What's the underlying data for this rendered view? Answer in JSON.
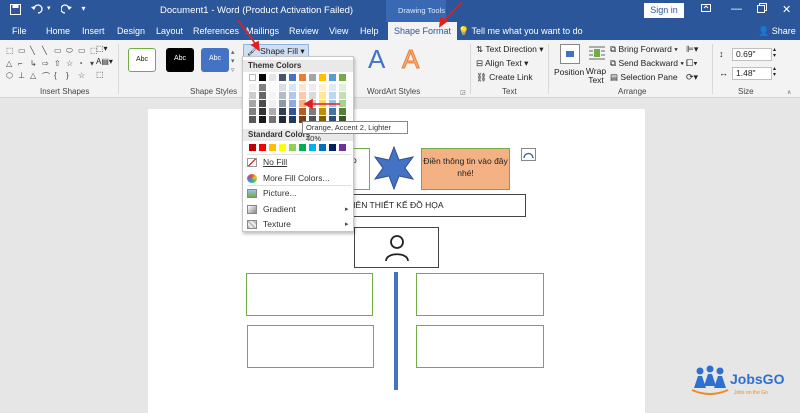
{
  "titlebar": {
    "save_icon": "save-icon",
    "undo_icon": "undo-icon",
    "redo_icon": "redo-icon",
    "customize_icon": "customize-icon",
    "title": "Document1 - Word (Product Activation Failed)",
    "context_label": "Drawing Tools",
    "signin": "Sign in"
  },
  "tabs": [
    {
      "label": "File"
    },
    {
      "label": "Home"
    },
    {
      "label": "Insert"
    },
    {
      "label": "Design"
    },
    {
      "label": "Layout"
    },
    {
      "label": "References"
    },
    {
      "label": "Mailings"
    },
    {
      "label": "Review"
    },
    {
      "label": "View"
    },
    {
      "label": "Help"
    },
    {
      "label": "Shape Format"
    }
  ],
  "tell_me": "Tell me what you want to do",
  "share": "Share",
  "ribbon": {
    "insert_shapes": "Insert Shapes",
    "shape_styles": "Shape Styles",
    "style_sample": "Abc",
    "shape_fill": "Shape Fill",
    "wordart_styles": "WordArt Styles",
    "wordart_sample": "A",
    "text_direction": "Text Direction",
    "align_text": "Align Text",
    "create_link": "Create Link",
    "text_group": "Text",
    "position": "Position",
    "wrap_text": "Wrap Text",
    "bring_forward": "Bring Forward",
    "send_backward": "Send Backward",
    "selection_pane": "Selection Pane",
    "arrange": "Arrange",
    "height": "0.69\"",
    "width": "1.48\"",
    "size": "Size"
  },
  "dropdown": {
    "theme_colors": "Theme Colors",
    "standard_colors": "Standard Colors",
    "no_fill": "No Fill",
    "more_fill_colors": "More Fill Colors...",
    "picture": "Picture...",
    "gradient": "Gradient",
    "texture": "Texture",
    "tooltip": "Orange, Accent 2, Lighter 40%",
    "theme_top": [
      "#ffffff",
      "#000000",
      "#e7e6e6",
      "#44546a",
      "#4472c4",
      "#ed7d31",
      "#a5a5a5",
      "#ffc000",
      "#5b9bd5",
      "#70ad47"
    ],
    "standard": [
      "#c00000",
      "#ff0000",
      "#ffc000",
      "#ffff00",
      "#92d050",
      "#00b050",
      "#00b0f0",
      "#0070c0",
      "#002060",
      "#7030a0"
    ]
  },
  "document": {
    "box_text_partial": "vào",
    "orange_text": "Điền thông tin vào đây nhé!",
    "title_text": "N VIÊN THIẾT KẾ ĐỒ HỌA"
  },
  "logo": {
    "name": "JobsGO",
    "tagline": "Jobs on the Go"
  },
  "colors": {
    "word_blue": "#2b579a",
    "accent_green": "#70ad47",
    "orange_fill": "#f4b183",
    "star_blue": "#4472c4",
    "annotation_red": "#e02020"
  }
}
